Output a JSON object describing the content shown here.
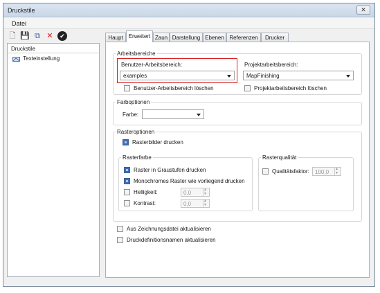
{
  "window": {
    "title": "Druckstile",
    "close": "✕"
  },
  "menu": {
    "file": "Datei"
  },
  "toolbar": {
    "new": "🗋",
    "save": "💾",
    "copy": "⧉",
    "delete": "✕",
    "check": "✔"
  },
  "sidebar": {
    "header": "Druckstile",
    "items": [
      {
        "label": "Texteinstellung"
      }
    ]
  },
  "tabs": [
    "Haupt",
    "Erweitert",
    "Zaun",
    "Darstellung",
    "Ebenen",
    "Referenzen",
    "Drucker"
  ],
  "arbeitsbereiche": {
    "title": "Arbeitsbereiche",
    "user_label": "Benutzer-Arbeitsbereich:",
    "user_value": "examples",
    "project_label": "Projektarbeitsbereich:",
    "project_value": "MapFinishing",
    "user_clear": "Benutzer-Arbeitsbereich löschen",
    "project_clear": "Projektarbeitsbereich löschen"
  },
  "farboptionen": {
    "title": "Farboptionen",
    "color_label": "Farbe:",
    "color_value": ""
  },
  "rasteroptionen": {
    "title": "Rasteroptionen",
    "print_raster": "Rasterbilder drucken",
    "rasterfarbe": {
      "title": "Rasterfarbe",
      "grayscale": "Raster in Graustufen drucken",
      "monochrome": "Monochromes Raster wie vorliegend drucken",
      "brightness_label": "Helligkeit:",
      "brightness_value": "0,0",
      "contrast_label": "Kontrast:",
      "contrast_value": "0,0"
    },
    "rasterqualitaet": {
      "title": "Rasterqualität",
      "quality_label": "Qualitätsfaktor:",
      "quality_value": "100,0"
    }
  },
  "options": {
    "update_from_drawing": "Aus Zeichnungsdatei aktualisieren",
    "update_names": "Druckdefinitionsnamen aktualisieren"
  }
}
